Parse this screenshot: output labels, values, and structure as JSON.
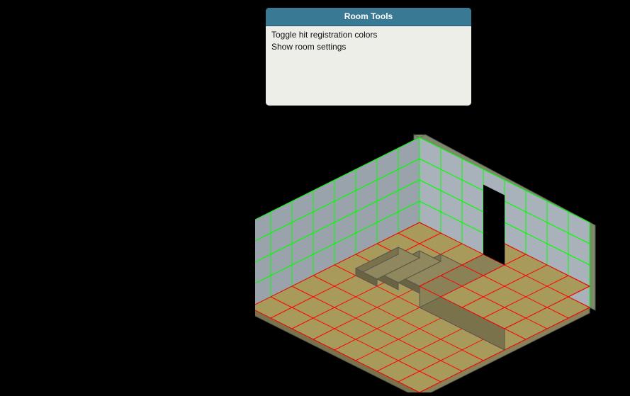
{
  "panel": {
    "title": "Room Tools",
    "items": [
      "Toggle hit registration colors",
      "Show room settings"
    ]
  },
  "room": {
    "floor_grid_color": "#ff0000",
    "wall_grid_color": "#00ff00",
    "floor_fill": "#a89a5b",
    "wall_fill": "#9aa3ab",
    "wall_trim": "#7d8a6a",
    "stair_fill": "#8f875e",
    "door_fill": "#000000"
  }
}
